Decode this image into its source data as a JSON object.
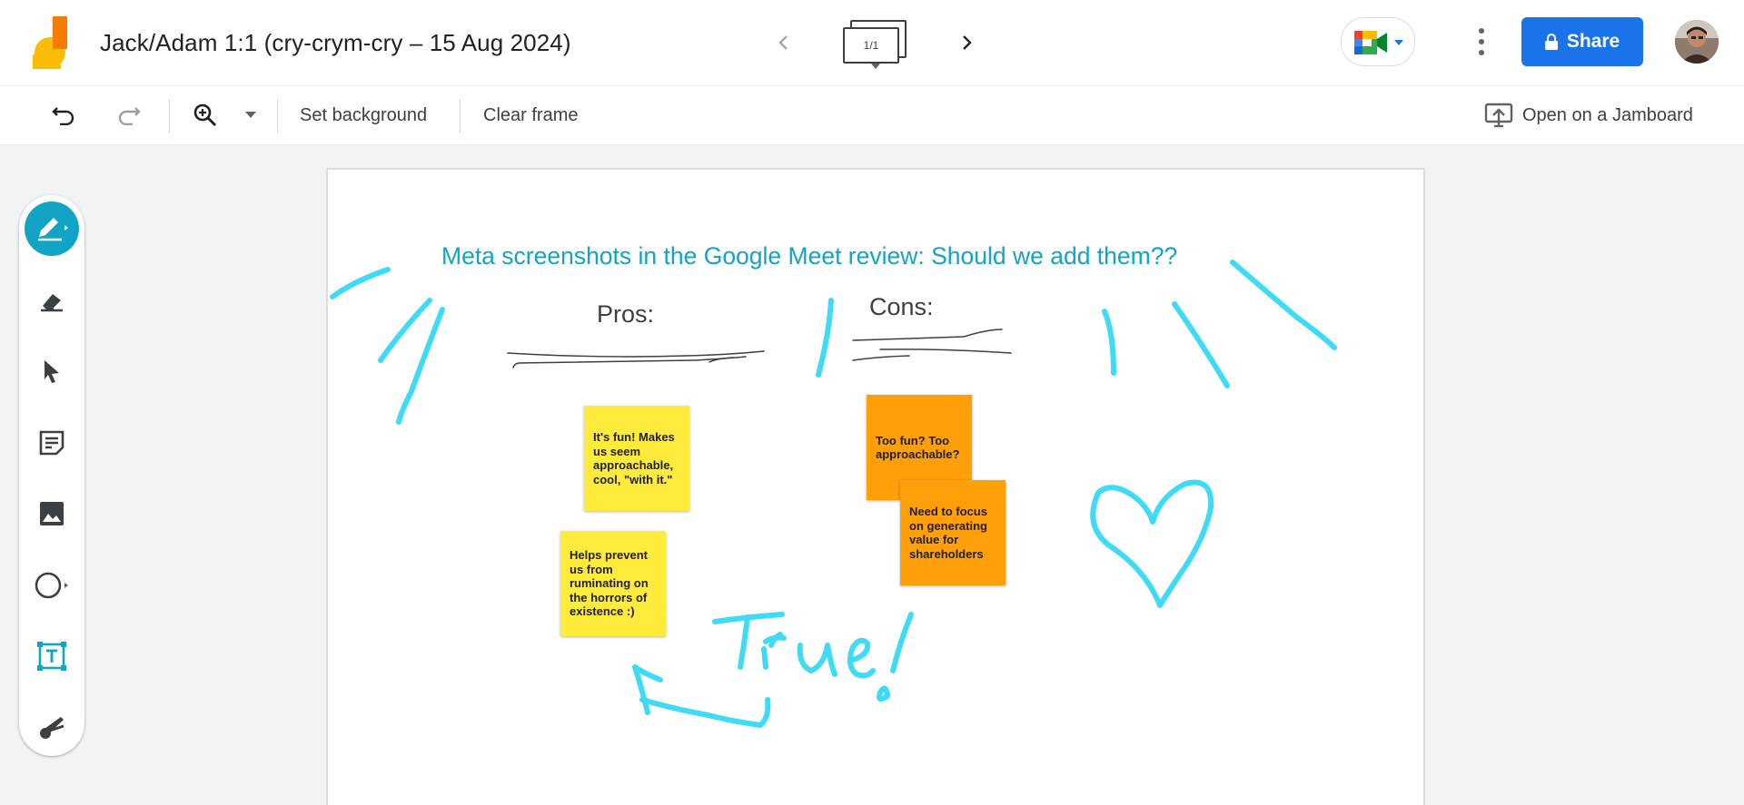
{
  "header": {
    "title": "Jack/Adam 1:1 (cry-crym-cry  – 15 Aug 2024)",
    "frame_counter": "1/1",
    "share_label": "Share"
  },
  "toolbar": {
    "set_background": "Set background",
    "clear_frame": "Clear frame",
    "open_on_jamboard": "Open on a Jamboard"
  },
  "tools": [
    "pen",
    "eraser",
    "select",
    "sticky-note",
    "image",
    "circle",
    "text-box",
    "laser"
  ],
  "frame": {
    "title": "Meta screenshots in the Google Meet review: Should we add them??",
    "pros_label": "Pros:",
    "cons_label": "Cons:",
    "handwriting": "True!",
    "stickies": [
      {
        "text": "It's fun! Makes us seem approachable, cool, \"with it.\"",
        "color": "#ffeb3b"
      },
      {
        "text": "Helps prevent us from ruminating on the horrors of existence :)",
        "color": "#ffeb3b"
      },
      {
        "text": "Too fun? Too approachable?",
        "color": "#ff9f0a"
      },
      {
        "text": "Need to focus on generating value for shareholders",
        "color": "#ff9f0a"
      }
    ]
  },
  "colors": {
    "accent_teal": "#12a4c4",
    "ink_cyan": "#2fd8f5",
    "share_blue": "#1a73e8",
    "sticky_yellow": "#ffeb3b",
    "sticky_orange": "#ff9f0a"
  }
}
